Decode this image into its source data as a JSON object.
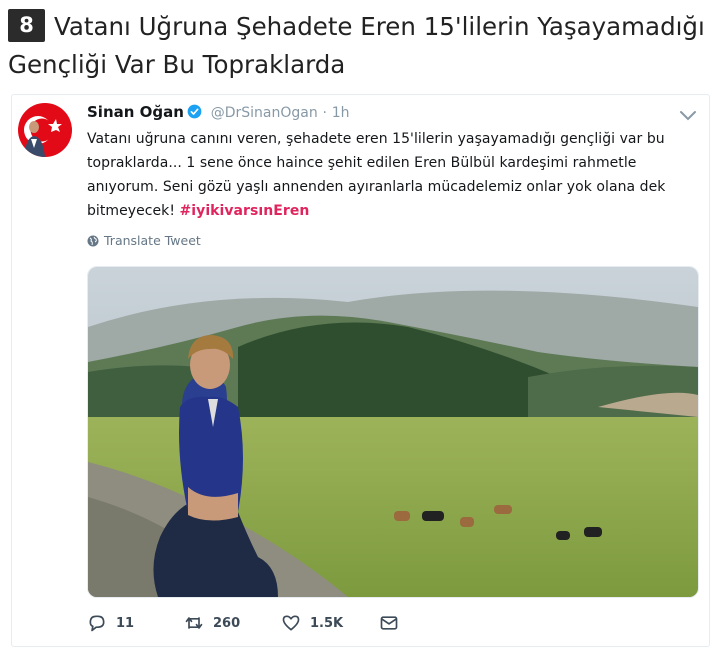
{
  "headline": {
    "number": "8",
    "title": "Vatanı Uğruna Şehadete Eren 15'lilerin Yaşayamadığı Gençliği Var Bu Topraklarda"
  },
  "tweet": {
    "author_name": "Sinan Oğan",
    "handle": "@DrSinanOgan",
    "separator": "·",
    "time": "1h",
    "text": "Vatanı uğruna canını veren, şehadete eren 15'lilerin yaşayamadığı gençliği var bu topraklarda... 1 sene önce haince şehit edilen Eren Bülbül kardeşimi rahmetle anıyorum. Seni gözü yaşlı annenden ayıranlarla mücadelemiz onlar yok olana dek bitmeyecek!",
    "hashtag": "#iyikivarsınEren",
    "translate_label": "Translate Tweet",
    "actions": {
      "replies": "11",
      "retweets": "260",
      "likes": "1.5K"
    }
  },
  "icons": [
    "verified-icon",
    "chevron-down-icon",
    "globe-icon",
    "reply-icon",
    "retweet-icon",
    "like-icon",
    "message-icon"
  ],
  "colors": {
    "hashtag": "#e0245e",
    "verified": "#1da1f2",
    "muted": "#8899a6",
    "badge": "#2b2b2b"
  }
}
